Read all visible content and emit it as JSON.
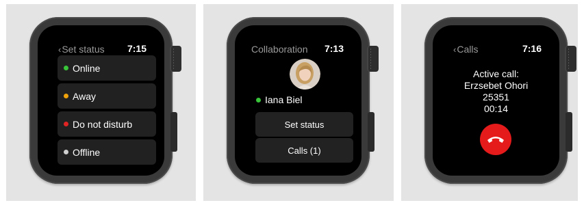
{
  "colors": {
    "online": "#39c53a",
    "away": "#f0a20a",
    "do_not_disturb": "#e02424",
    "offline": "#cfcfcf",
    "end_call": "#e51b1b"
  },
  "set_status_screen": {
    "back_label": "Set status",
    "time": "7:15",
    "items": [
      {
        "label": "Online",
        "status": "online"
      },
      {
        "label": "Away",
        "status": "away"
      },
      {
        "label": "Do not disturb",
        "status": "do_not_disturb"
      },
      {
        "label": "Offline",
        "status": "offline"
      }
    ]
  },
  "collaboration_screen": {
    "title": "Collaboration",
    "time": "7:13",
    "user_name": "Iana Biel",
    "user_status": "online",
    "set_status_button": "Set status",
    "calls_button": "Calls (1)"
  },
  "calls_screen": {
    "back_label": "Calls",
    "time": "7:16",
    "heading": "Active call:",
    "caller": "Erzsebet Ohori",
    "number": "25351",
    "duration": "00:14",
    "end_call_icon": "phone-hangup-icon"
  }
}
